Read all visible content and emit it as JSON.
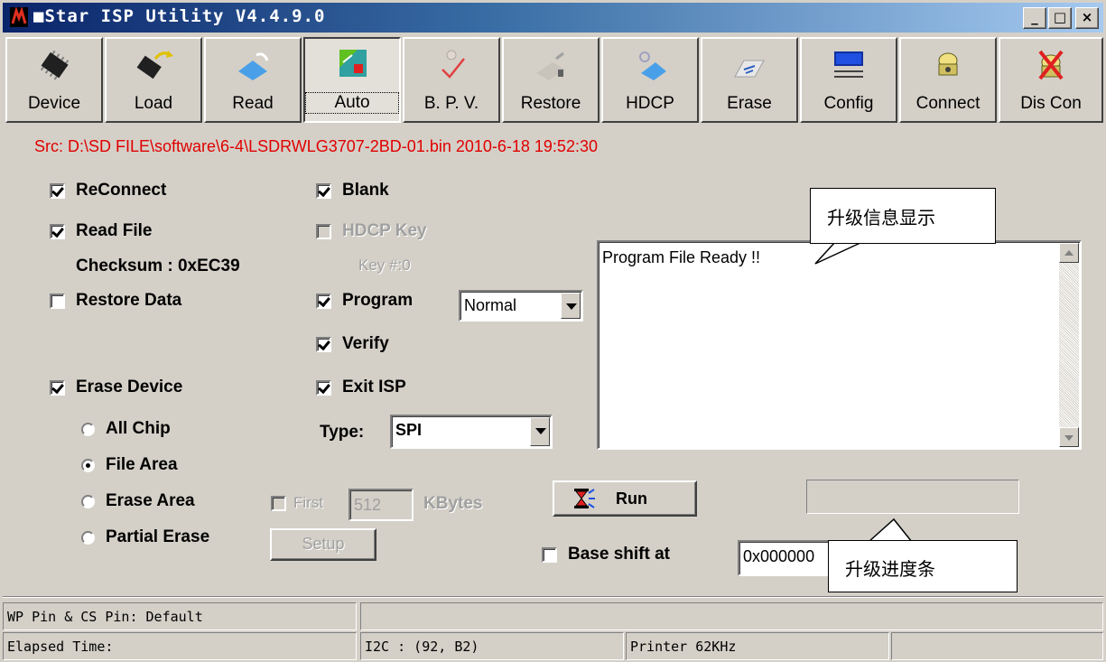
{
  "window": {
    "title": "■Star ISP Utility V4.4.9.0",
    "controls": {
      "minimize": "_",
      "maximize": "□",
      "close": "×"
    }
  },
  "toolbar": [
    {
      "label": "Device",
      "icon": "chip-icon"
    },
    {
      "label": "Load",
      "icon": "chip-load-icon"
    },
    {
      "label": "Read",
      "icon": "read-icon"
    },
    {
      "label": "Auto",
      "icon": "auto-icon",
      "active": true
    },
    {
      "label": "B. P. V.",
      "icon": "bpv-icon"
    },
    {
      "label": "Restore",
      "icon": "restore-icon"
    },
    {
      "label": "HDCP",
      "icon": "hdcp-icon"
    },
    {
      "label": "Erase",
      "icon": "erase-icon"
    },
    {
      "label": "Config",
      "icon": "config-icon"
    },
    {
      "label": "Connect",
      "icon": "phone-icon"
    },
    {
      "label": "Dis Con",
      "icon": "disconnect-icon"
    }
  ],
  "source_line": "Src: D:\\SD FILE\\software\\6-4\\LSDRWLG3707-2BD-01.bin 2010-6-18 19:52:30",
  "options": {
    "reconnect": "ReConnect",
    "read_file": "Read File",
    "checksum": "Checksum : 0xEC39",
    "restore_data": "Restore Data",
    "erase_device": "Erase Device",
    "all_chip": "All Chip",
    "file_area": "File Area",
    "erase_area": "Erase Area",
    "partial_erase": "Partial Erase",
    "blank": "Blank",
    "hdcp_key": "HDCP Key",
    "key_num": "Key #:0",
    "program": "Program",
    "program_mode": "Normal",
    "verify": "Verify",
    "exit_isp": "Exit ISP",
    "type_label": "Type:",
    "type_value": "SPI",
    "first": "First",
    "first_value": "512",
    "kbytes": "KBytes",
    "setup": "Setup",
    "run": "Run",
    "base_shift": "Base shift at",
    "base_shift_value": "0x000000"
  },
  "message": "Program File Ready !!",
  "callouts": {
    "info": "升级信息显示",
    "progress": "升级进度条"
  },
  "status": {
    "row1_left": "WP Pin & CS Pin: Default",
    "row2_left": "Elapsed Time:",
    "i2c": "I2C :  (92, B2)",
    "printer": "Printer  62KHz"
  },
  "colors": {
    "source_text": "#e00000",
    "titlebar_start": "#0a246a",
    "titlebar_end": "#a6caf0"
  }
}
